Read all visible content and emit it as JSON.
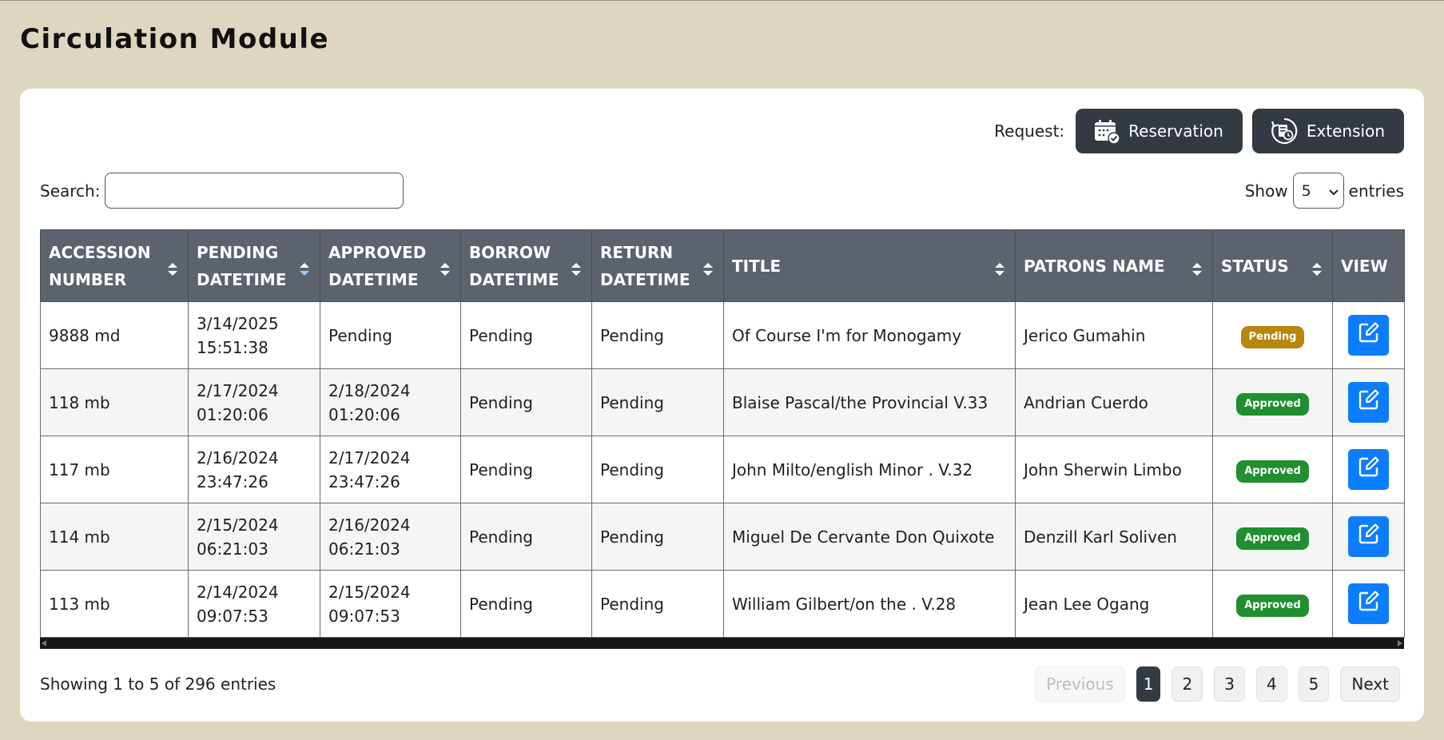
{
  "page": {
    "title": "Circulation Module"
  },
  "request": {
    "label": "Request:",
    "reservation_label": "Reservation",
    "extension_label": "Extension"
  },
  "search": {
    "label": "Search:",
    "value": "",
    "placeholder": ""
  },
  "entries": {
    "show_label": "Show",
    "selected": "5",
    "suffix": "entries"
  },
  "table": {
    "headers": {
      "accession_line1": "ACCESSION",
      "accession_line2": "NUMBER",
      "pending_line1": "PENDING",
      "pending_line2": "DATETIME",
      "approved_line1": "APPROVED",
      "approved_line2": "DATETIME",
      "borrow_line1": "BORROW",
      "borrow_line2": "DATETIME",
      "return_line1": "RETURN",
      "return_line2": "DATETIME",
      "title": "TITLE",
      "patrons": "PATRONS NAME",
      "status": "STATUS",
      "view": "VIEW"
    },
    "rows": [
      {
        "accession": "9888 md",
        "pending_date": "3/14/2025",
        "pending_time": "15:51:38",
        "approved_date": "Pending",
        "approved_time": "",
        "borrow": "Pending",
        "return": "Pending",
        "title": "Of Course I'm for Monogamy",
        "patron": "Jerico Gumahin",
        "status": "Pending"
      },
      {
        "accession": "118 mb",
        "pending_date": "2/17/2024",
        "pending_time": "01:20:06",
        "approved_date": "2/18/2024",
        "approved_time": "01:20:06",
        "borrow": "Pending",
        "return": "Pending",
        "title": "Blaise Pascal/the Provincial V.33",
        "patron": "Andrian Cuerdo",
        "status": "Approved"
      },
      {
        "accession": "117 mb",
        "pending_date": "2/16/2024",
        "pending_time": "23:47:26",
        "approved_date": "2/17/2024",
        "approved_time": "23:47:26",
        "borrow": "Pending",
        "return": "Pending",
        "title": "John Milto/english Minor . V.32",
        "patron": "John Sherwin Limbo",
        "status": "Approved"
      },
      {
        "accession": "114 mb",
        "pending_date": "2/15/2024",
        "pending_time": "06:21:03",
        "approved_date": "2/16/2024",
        "approved_time": "06:21:03",
        "borrow": "Pending",
        "return": "Pending",
        "title": "Miguel De Cervante Don Quixote",
        "patron": "Denzill Karl Soliven",
        "status": "Approved"
      },
      {
        "accession": "113 mb",
        "pending_date": "2/14/2024",
        "pending_time": "09:07:53",
        "approved_date": "2/15/2024",
        "approved_time": "09:07:53",
        "borrow": "Pending",
        "return": "Pending",
        "title": "William Gilbert/on the . V.28",
        "patron": "Jean Lee Ogang",
        "status": "Approved"
      }
    ]
  },
  "status_colors": {
    "Pending": "#b8860b",
    "Approved": "#1f8f2f"
  },
  "footer": {
    "info": "Showing 1 to 5 of 296 entries"
  },
  "pagination": {
    "previous": "Previous",
    "pages": [
      "1",
      "2",
      "3",
      "4",
      "5"
    ],
    "active_page": "1",
    "next": "Next"
  },
  "icons": {
    "reservation": "calendar-check-icon",
    "extension": "renew-icon",
    "view": "edit-icon",
    "sort": "sort-arrows-icon"
  }
}
